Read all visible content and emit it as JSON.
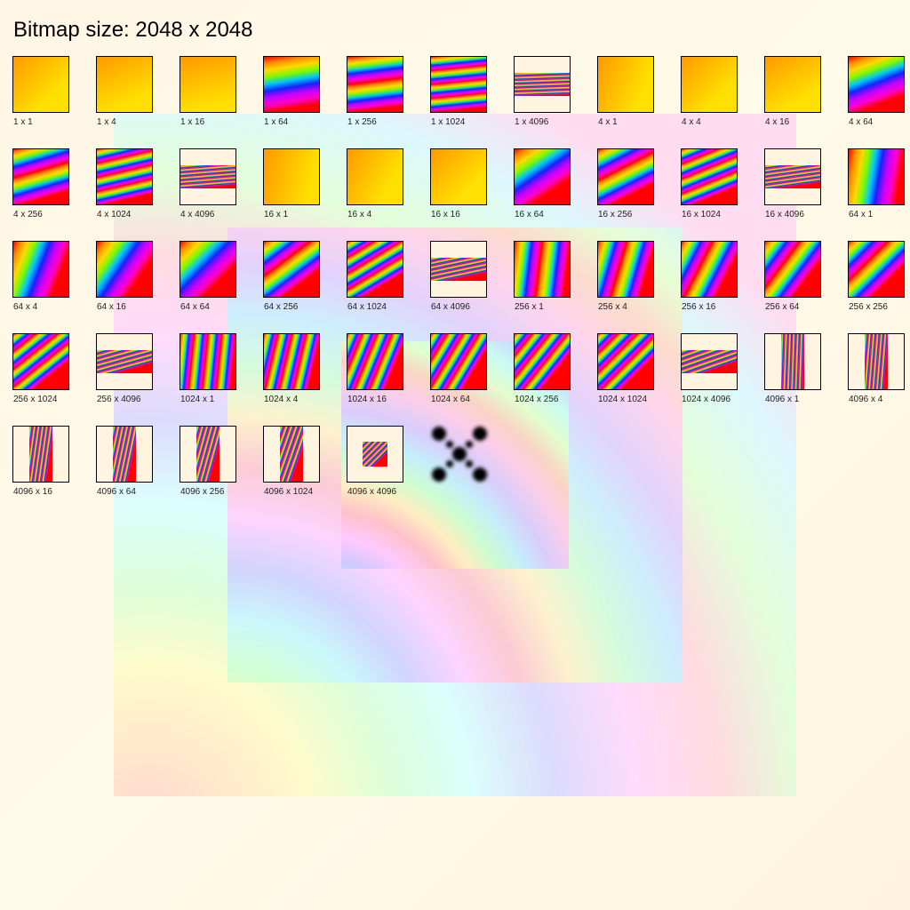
{
  "header": {
    "title": "Bitmap size: 2048 x 2048"
  },
  "thumbnails": [
    {
      "label": "1 x 1",
      "w": 1,
      "h": 1
    },
    {
      "label": "1 x 4",
      "w": 1,
      "h": 4
    },
    {
      "label": "1 x 16",
      "w": 1,
      "h": 16
    },
    {
      "label": "1 x 64",
      "w": 1,
      "h": 64
    },
    {
      "label": "1 x 256",
      "w": 1,
      "h": 256
    },
    {
      "label": "1 x 1024",
      "w": 1,
      "h": 1024
    },
    {
      "label": "1 x 4096",
      "w": 1,
      "h": 4096
    },
    {
      "label": "4 x 1",
      "w": 4,
      "h": 1
    },
    {
      "label": "4 x 4",
      "w": 4,
      "h": 4
    },
    {
      "label": "4 x 16",
      "w": 4,
      "h": 16
    },
    {
      "label": "4 x 64",
      "w": 4,
      "h": 64
    },
    {
      "label": "4 x 256",
      "w": 4,
      "h": 256
    },
    {
      "label": "4 x 1024",
      "w": 4,
      "h": 1024
    },
    {
      "label": "4 x 4096",
      "w": 4,
      "h": 4096
    },
    {
      "label": "16 x 1",
      "w": 16,
      "h": 1
    },
    {
      "label": "16 x 4",
      "w": 16,
      "h": 4
    },
    {
      "label": "16 x 16",
      "w": 16,
      "h": 16
    },
    {
      "label": "16 x 64",
      "w": 16,
      "h": 64
    },
    {
      "label": "16 x 256",
      "w": 16,
      "h": 256
    },
    {
      "label": "16 x 1024",
      "w": 16,
      "h": 1024
    },
    {
      "label": "16 x 4096",
      "w": 16,
      "h": 4096
    },
    {
      "label": "64 x 1",
      "w": 64,
      "h": 1
    },
    {
      "label": "64 x 4",
      "w": 64,
      "h": 4
    },
    {
      "label": "64 x 16",
      "w": 64,
      "h": 16
    },
    {
      "label": "64 x 64",
      "w": 64,
      "h": 64
    },
    {
      "label": "64 x 256",
      "w": 64,
      "h": 256
    },
    {
      "label": "64 x 1024",
      "w": 64,
      "h": 1024
    },
    {
      "label": "64 x 4096",
      "w": 64,
      "h": 4096
    },
    {
      "label": "256 x 1",
      "w": 256,
      "h": 1
    },
    {
      "label": "256 x 4",
      "w": 256,
      "h": 4
    },
    {
      "label": "256 x 16",
      "w": 256,
      "h": 16
    },
    {
      "label": "256 x 64",
      "w": 256,
      "h": 64
    },
    {
      "label": "256 x 256",
      "w": 256,
      "h": 256
    },
    {
      "label": "256 x 1024",
      "w": 256,
      "h": 1024
    },
    {
      "label": "256 x 4096",
      "w": 256,
      "h": 4096
    },
    {
      "label": "1024 x 1",
      "w": 1024,
      "h": 1
    },
    {
      "label": "1024 x 4",
      "w": 1024,
      "h": 4
    },
    {
      "label": "1024 x 16",
      "w": 1024,
      "h": 16
    },
    {
      "label": "1024 x 64",
      "w": 1024,
      "h": 64
    },
    {
      "label": "1024 x 256",
      "w": 1024,
      "h": 256
    },
    {
      "label": "1024 x 1024",
      "w": 1024,
      "h": 1024
    },
    {
      "label": "1024 x 4096",
      "w": 1024,
      "h": 4096
    },
    {
      "label": "4096 x 1",
      "w": 4096,
      "h": 1
    },
    {
      "label": "4096 x 4",
      "w": 4096,
      "h": 4
    },
    {
      "label": "4096 x 16",
      "w": 4096,
      "h": 16
    },
    {
      "label": "4096 x 64",
      "w": 4096,
      "h": 64
    },
    {
      "label": "4096 x 256",
      "w": 4096,
      "h": 256
    },
    {
      "label": "4096 x 1024",
      "w": 4096,
      "h": 1024
    },
    {
      "label": "4096 x 4096",
      "w": 4096,
      "h": 4096
    }
  ],
  "colors": {
    "background": "#fff9e6",
    "border": "#000000",
    "label": "#222222",
    "rainbow": [
      "#ff0000",
      "#ff8c00",
      "#ffd700",
      "#7cfc00",
      "#00c8ff",
      "#1e1eff",
      "#c800ff",
      "#ff00c8"
    ]
  }
}
